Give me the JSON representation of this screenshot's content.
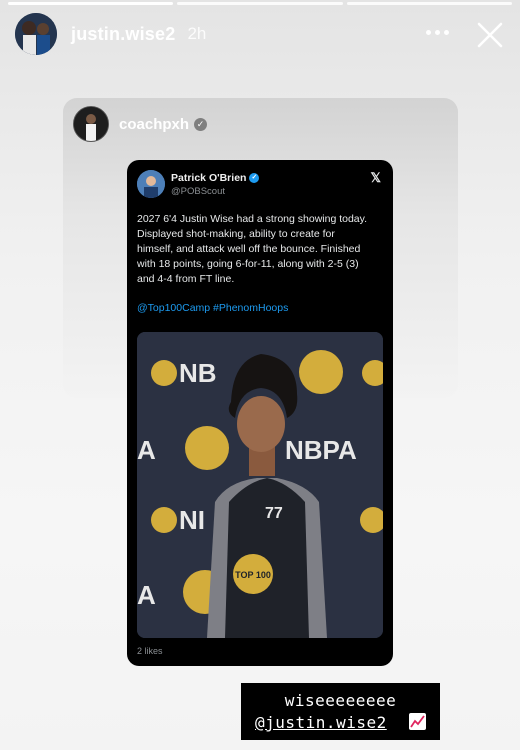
{
  "story": {
    "progress_segments": 3,
    "active_segment": 1,
    "username": "justin.wise2",
    "time_ago": "2h"
  },
  "post": {
    "username": "coachpxh"
  },
  "tweet": {
    "author_name": "Patrick O'Brien",
    "author_handle": "@POBScout",
    "text": "2027 6'4 Justin Wise had a strong showing today.\nDisplayed shot-making, ability to create for\nhimself, and attack well off the bounce. Finished\nwith 18 points, going 6-for-11, along with 2-5 (3)\nand 4-4 from FT line.",
    "hashtags": "@Top100Camp #PhenomHoops",
    "likes": "2 likes",
    "media": {
      "banner_texts": [
        "NBPA",
        "NB",
        "A",
        "NBPA",
        "NI",
        "A"
      ],
      "logo_text": "TOP 100",
      "jersey_number": "77"
    }
  },
  "caption": {
    "line1": "wiseeeeeeee",
    "line2": "@justin.wise2"
  },
  "colors": {
    "link": "#1d9bf0",
    "tweet_bg": "#000000",
    "gold": "#c9a227"
  },
  "icons": [
    "more-icon",
    "close-icon",
    "verified-icon",
    "x-logo-icon",
    "chart-increasing-icon"
  ]
}
